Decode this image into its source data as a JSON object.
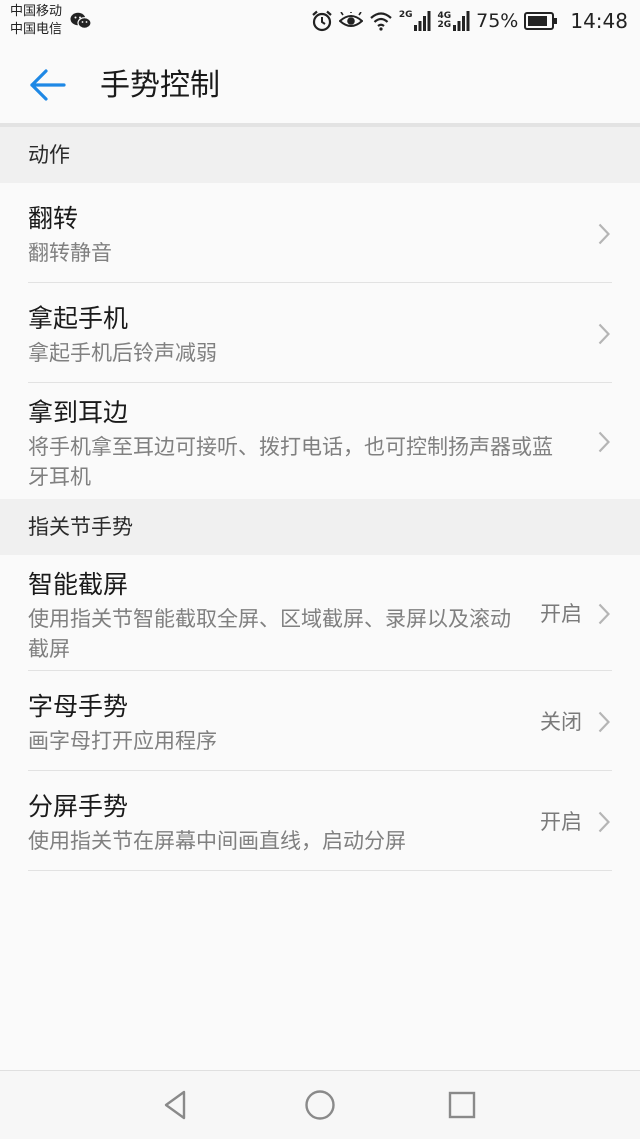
{
  "status_bar": {
    "carrier_1": "中国移动",
    "carrier_2": "中国电信",
    "net_1": "2G",
    "net_2_top": "4G",
    "net_2_bottom": "2G",
    "battery": "75%",
    "time": "14:48",
    "icons": [
      "wechat-icon",
      "alarm-icon",
      "eye-comfort-icon",
      "wifi-icon",
      "signal-icon",
      "battery-icon"
    ]
  },
  "app_bar": {
    "back_icon": "arrow-left-icon",
    "title": "手势控制"
  },
  "sections": [
    {
      "header": "动作",
      "items": [
        {
          "title": "翻转",
          "subtitle": "翻转静音",
          "status": ""
        },
        {
          "title": "拿起手机",
          "subtitle": "拿起手机后铃声减弱",
          "status": ""
        },
        {
          "title": "拿到耳边",
          "subtitle": "将手机拿至耳边可接听、拨打电话，也可控制扬声器或蓝牙耳机",
          "status": ""
        }
      ]
    },
    {
      "header": "指关节手势",
      "items": [
        {
          "title": "智能截屏",
          "subtitle": "使用指关节智能截取全屏、区域截屏、录屏以及滚动截屏",
          "status": "开启"
        },
        {
          "title": "字母手势",
          "subtitle": "画字母打开应用程序",
          "status": "关闭"
        },
        {
          "title": "分屏手势",
          "subtitle": "使用指关节在屏幕中间画直线，启动分屏",
          "status": "开启"
        }
      ]
    }
  ],
  "nav_bar": {
    "icons": [
      "back-triangle-icon",
      "home-circle-icon",
      "recents-square-icon"
    ]
  },
  "colors": {
    "accent": "#1e88e5",
    "background": "#fafafa",
    "section_background": "#f0f0f0",
    "subtitle_text": "#808080",
    "divider": "#e2e2e2"
  }
}
